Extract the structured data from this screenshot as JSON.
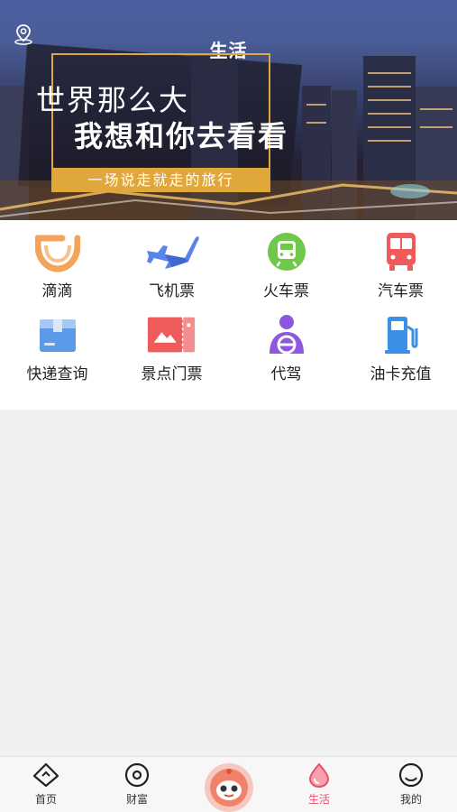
{
  "header": {
    "title": "生活",
    "location_icon": "location-pin-icon"
  },
  "banner": {
    "slogan_line1": "世界那么大",
    "slogan_line2": "我想和你去看看",
    "slogan_tagline": "一场说走就走的旅行",
    "accent_color": "#e0a73a"
  },
  "services": [
    {
      "label": "滴滴",
      "icon": "didi-icon",
      "color": "#f4a35a"
    },
    {
      "label": "飞机票",
      "icon": "airplane-icon",
      "color": "#5b84e8"
    },
    {
      "label": "火车票",
      "icon": "train-icon",
      "color": "#6fc84a"
    },
    {
      "label": "汽车票",
      "icon": "bus-icon",
      "color": "#ef5a5a"
    },
    {
      "label": "快递查询",
      "icon": "package-icon",
      "color": "#5b9ae8"
    },
    {
      "label": "景点门票",
      "icon": "ticket-icon",
      "color": "#ef5a5a"
    },
    {
      "label": "代驾",
      "icon": "driver-icon",
      "color": "#8e57e0"
    },
    {
      "label": "油卡充值",
      "icon": "fuel-pump-icon",
      "color": "#3c8fe6"
    }
  ],
  "tabbar": {
    "items": [
      {
        "label": "首页",
        "icon": "home-icon"
      },
      {
        "label": "财富",
        "icon": "wealth-icon"
      },
      {
        "label": "",
        "icon": "mascot-icon"
      },
      {
        "label": "生活",
        "icon": "drop-icon",
        "active": true
      },
      {
        "label": "我的",
        "icon": "smile-icon"
      }
    ],
    "active_color": "#e8526a"
  }
}
